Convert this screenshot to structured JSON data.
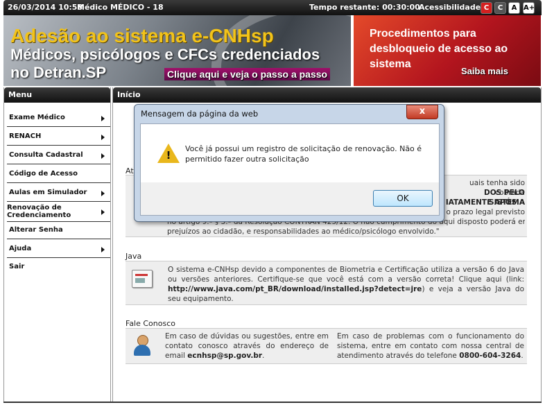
{
  "topbar": {
    "datetime": "26/03/2014 10:58",
    "user": "Médico MÉDICO - 18",
    "timer": "Tempo restante: 00:30:00",
    "accessibility_label": "Acessibilidade:",
    "buttons": [
      "C",
      "C",
      "A",
      "A+"
    ]
  },
  "banner_left": {
    "line1": "Adesão ao sistema e-CNHsp",
    "line2": "Médicos, psicólogos e CFCs credenciados",
    "line3": "no Detran.SP",
    "link": "Clique aqui e veja o passo a passo"
  },
  "banner_right": {
    "text": "Procedimentos para desbloqueio de acesso ao sistema",
    "link": "Saiba mais"
  },
  "menu": {
    "title": "Menu",
    "items": [
      {
        "label": "Exame Médico"
      },
      {
        "label": "RENACH"
      },
      {
        "label": "Consulta Cadastral"
      },
      {
        "label": "Código de Acesso"
      },
      {
        "label": "Aulas em Simulador"
      },
      {
        "label": "Renovação de Credenciamento"
      },
      {
        "label": "Alterar Senha"
      },
      {
        "label": "Ajuda"
      },
      {
        "label": "Sair"
      }
    ]
  },
  "content": {
    "title": "Início",
    "partial_title": "At",
    "partial_text_a": "uais tenha sido cobrada",
    "partial_text_b": "DOS PELO SISTEMA",
    "partial_text_c": "IATAMENTE APÓS A",
    "partial_text_d": "ir o prazo legal previsto",
    "partial_text_e": "no artigo 9.º § 3.º da Resolução CONTRAN 425/12. O não cumprimento do aqui disposto poderá ensejar",
    "partial_text_f": "prejuízos ao cidadão, e responsabilidades ao médico/psicólogo envolvido.\"",
    "java_title": "Java",
    "java_text_1": "O sistema e-CNHsp devido a componentes de Biometria e Certificação utiliza a versão 6 do Java ou versões anteriores. Certifique-se que você está com a versão correta! Clique aqui (link: ",
    "java_link": "http://www.java.com/pt_BR/download/installed.jsp?detect=jre",
    "java_text_2": ") e veja a versão Java do seu equipamento.",
    "contact_title": "Fale Conosco",
    "contact_left_1": "Em caso de dúvidas ou sugestões, entre em contato conosco através do endereço de email ",
    "contact_email": "ecnhsp@sp.gov.br",
    "contact_left_2": ".",
    "contact_right_1": "Em caso de problemas com o funcionamento do sistema, entre em contato com nossa central de atendimento através do telefone ",
    "contact_phone": "0800-604-3264",
    "contact_right_2": "."
  },
  "dialog": {
    "title": "Mensagem da página da web",
    "close": "x",
    "message": "Você já possui um registro de solicitação de renovação. Não é permitido fazer outra solicitação",
    "ok": "OK"
  }
}
